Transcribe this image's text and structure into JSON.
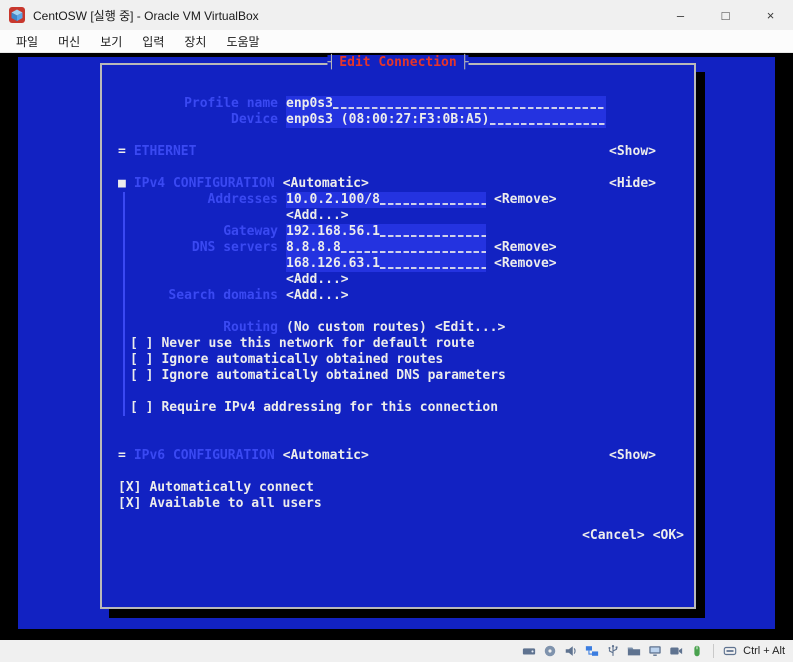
{
  "colors": {
    "terminal_blue": "#1222c2",
    "field_blue": "#2433e0",
    "label_blue": "#3a49f2",
    "title_red": "#e5352b",
    "border_gray": "#b9b9b9",
    "text_white": "#ececec"
  },
  "titlebar": {
    "title": "CentOSW [실행 중] - Oracle VM VirtualBox",
    "minimize": "–",
    "maximize": "□",
    "close": "×"
  },
  "menubar": {
    "items": [
      {
        "label": "파일"
      },
      {
        "label": "머신"
      },
      {
        "label": "보기"
      },
      {
        "label": "입력"
      },
      {
        "label": "장치"
      },
      {
        "label": "도움말"
      }
    ]
  },
  "dialog": {
    "tick_left": "┤",
    "tick_right": "├",
    "title": "Edit Connection",
    "fields": {
      "profile_name": {
        "label": "Profile name",
        "value": "enp0s3"
      },
      "device": {
        "label": "Device",
        "value": "enp0s3 (08:00:27:F3:0B:A5)"
      }
    },
    "sections": {
      "ethernet": {
        "marker": "=",
        "label": "ETHERNET",
        "action": "<Show>"
      },
      "ipv4": {
        "marker": "■",
        "label": "IPv4 CONFIGURATION",
        "mode": "<Automatic>",
        "action": "<Hide>"
      },
      "ipv6": {
        "marker": "=",
        "label": "IPv6 CONFIGURATION",
        "mode": "<Automatic>",
        "action": "<Show>"
      }
    },
    "ipv4": {
      "addresses_label": "Addresses",
      "addresses": [
        {
          "value": "10.0.2.100/8",
          "remove": "<Remove>"
        }
      ],
      "addresses_add": "<Add...>",
      "gateway_label": "Gateway",
      "gateway_value": "192.168.56.1",
      "dns_label": "DNS servers",
      "dns": [
        {
          "value": "8.8.8.8",
          "remove": "<Remove>"
        },
        {
          "value": "168.126.63.1",
          "remove": "<Remove>"
        }
      ],
      "dns_add": "<Add...>",
      "search_label": "Search domains",
      "search_add": "<Add...>",
      "routing_label": "Routing",
      "routing_value": "(No custom routes)",
      "routing_edit": "<Edit...>",
      "checkboxes": [
        {
          "state": "[ ]",
          "label": "Never use this network for default route"
        },
        {
          "state": "[ ]",
          "label": "Ignore automatically obtained routes"
        },
        {
          "state": "[ ]",
          "label": "Ignore automatically obtained DNS parameters"
        },
        {
          "state": "[ ]",
          "label": "Require IPv4 addressing for this connection"
        }
      ]
    },
    "bottom_checkboxes": [
      {
        "state": "[X]",
        "label": "Automatically connect"
      },
      {
        "state": "[X]",
        "label": "Available to all users"
      }
    ],
    "buttons": {
      "cancel": "<Cancel>",
      "ok": "<OK>"
    }
  },
  "statusbar": {
    "icons": [
      "harddisk-icon",
      "optical-disc-icon",
      "audio-icon",
      "network-icon",
      "usb-icon",
      "shared-folder-icon",
      "display-icon",
      "recording-icon",
      "mouse-icon"
    ],
    "host_key_label": "Ctrl + Alt"
  }
}
